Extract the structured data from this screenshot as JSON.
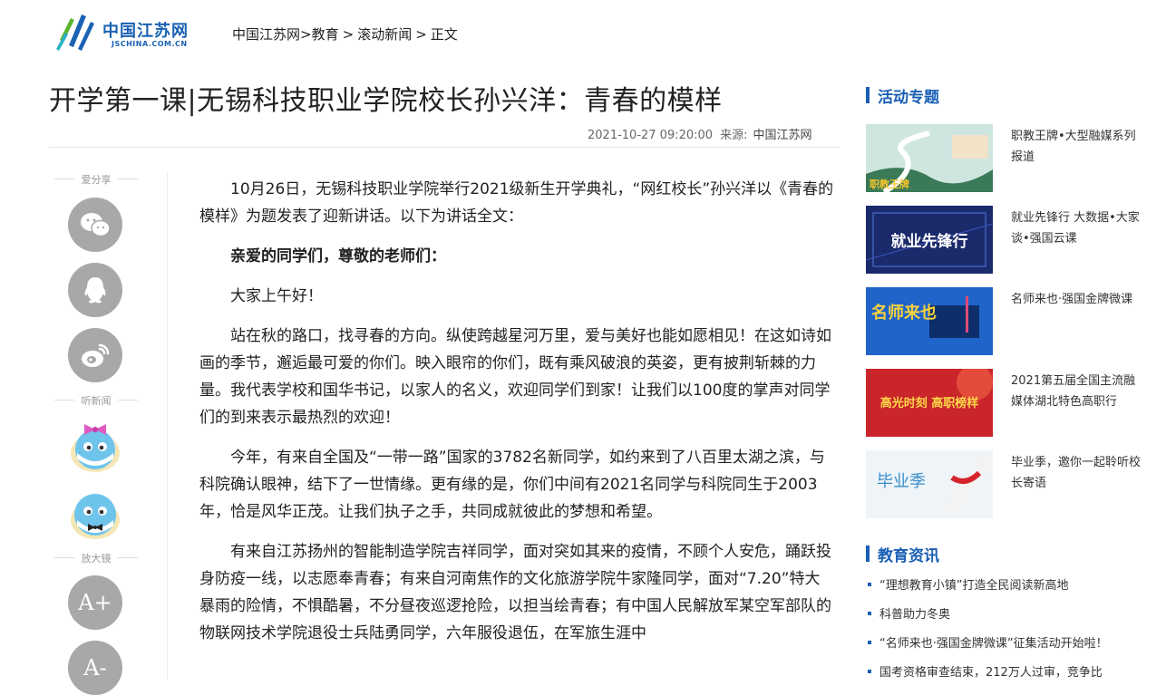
{
  "site": {
    "logo_name": "中国江苏网",
    "logo_domain": "JSCHINA.COM.CN",
    "brand_color": "#1a62b3",
    "accent_green": "#5cb531"
  },
  "breadcrumb": {
    "items": [
      "中国江苏网",
      "教育",
      "滚动新闻",
      "正文"
    ],
    "sep": ">"
  },
  "article": {
    "title": "开学第一课|无锡科技职业学院校长孙兴洋：青春的模样",
    "datetime": "2021-10-27 09:20:00",
    "source_label": "来源:",
    "source": "中国江苏网",
    "paragraphs": [
      "10月26日，无锡科技职业学院举行2021级新生开学典礼，“网红校长”孙兴洋以《青春的模样》为题发表了迎新讲话。以下为讲话全文：",
      "亲爱的同学们，尊敬的老师们：",
      "大家上午好！",
      "站在秋的路口，找寻春的方向。纵使跨越星河万里，爱与美好也能如愿相见！在这如诗如画的季节，邂逅最可爱的你们。映入眼帘的你们，既有乘风破浪的英姿，更有披荆斩棘的力量。我代表学校和国华书记，以家人的名义，欢迎同学们到家！让我们以100度的掌声对同学们的到来表示最热烈的欢迎！",
      "今年，有来自全国及“一带一路”国家的3782名新同学，如约来到了八百里太湖之滨，与科院确认眼神，结下了一世情缘。更有缘的是，你们中间有2021名同学与科院同生于2003年，恰是风华正茂。让我们执子之手，共同成就彼此的梦想和希望。",
      "有来自江苏扬州的智能制造学院吉祥同学，面对突如其来的疫情，不顾个人安危，踊跃投身防疫一线，以志愿奉青春；有来自河南焦作的文化旅游学院牛家隆同学，面对“7.20”特大暴雨的险情，不惧酷暑，不分昼夜巡逻抢险，以担当绘青春；有中国人民解放军某空军部队的物联网技术学院退役士兵陆勇同学，六年服役退伍，在军旅生涯中"
    ],
    "bold_paragraph_index": 1
  },
  "share": {
    "share_label": "爱分享",
    "listen_label": "听新闻",
    "magnifier_label": "放大镜",
    "icons": [
      "wechat-icon",
      "qq-icon",
      "weibo-icon"
    ],
    "zoom_in": "A+",
    "zoom_out": "A-"
  },
  "sidebar": {
    "topics_title": "活动专题",
    "topics": [
      {
        "text": "职教王牌•大型融媒系列报道",
        "thumb_caption": "职教王牌"
      },
      {
        "text": "就业先锋行 大数据•大家谈•强国云课",
        "thumb_caption": "就业先锋行"
      },
      {
        "text": "名师来也·强国金牌微课",
        "thumb_caption": "名师来也"
      },
      {
        "text": "2021第五届全国主流融媒体湖北特色高职行",
        "thumb_caption": "高光时刻 高职榜样"
      },
      {
        "text": "毕业季，邀你一起聆听校长寄语",
        "thumb_caption": "毕业季"
      }
    ],
    "news_title": "教育资讯",
    "news": [
      "“理想教育小镇”打造全民阅读新高地",
      "科普助力冬奥",
      "“名师来也·强国金牌微课”征集活动开始啦！",
      "国考资格审查结束，212万人过审，竞争比"
    ]
  }
}
